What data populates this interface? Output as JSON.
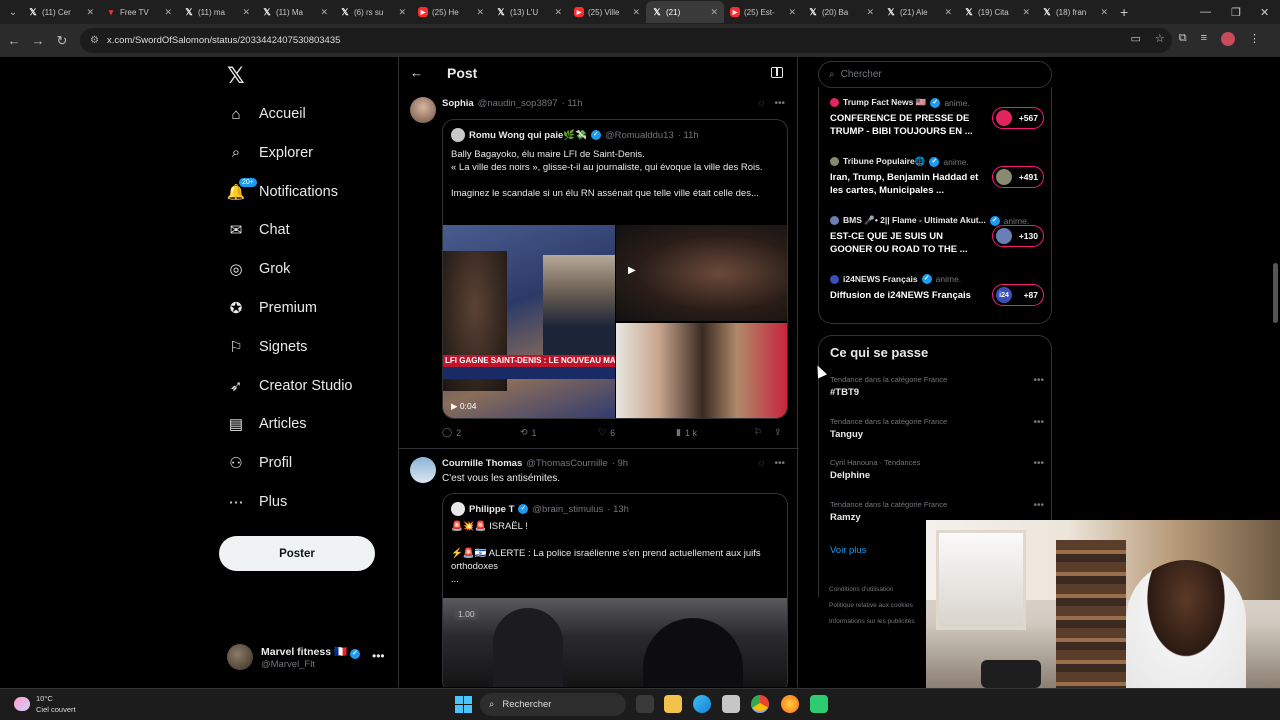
{
  "browser": {
    "tabs": [
      {
        "title": "(11) Cer",
        "icon": "x"
      },
      {
        "title": "Free TV",
        "icon": "freetv"
      },
      {
        "title": "(11) ma",
        "icon": "x"
      },
      {
        "title": "(11) Ma",
        "icon": "x"
      },
      {
        "title": "(6) rs su",
        "icon": "x"
      },
      {
        "title": "(25) He",
        "icon": "youtube"
      },
      {
        "title": "(13) L'U",
        "icon": "x"
      },
      {
        "title": "(25) Ville",
        "icon": "youtube"
      },
      {
        "title": "(21)",
        "icon": "x"
      },
      {
        "title": "(25) Est-",
        "icon": "youtube"
      },
      {
        "title": "(20) Ba",
        "icon": "x"
      },
      {
        "title": "(21) Ale",
        "icon": "x"
      },
      {
        "title": "(19) Cita",
        "icon": "x"
      },
      {
        "title": "(18) fran",
        "icon": "x"
      }
    ],
    "active_tab_index": 8,
    "url": "x.com/SwordOfSalomon/status/2033442407530803435"
  },
  "nav": {
    "items": [
      {
        "label": "Accueil",
        "icon": "home-icon"
      },
      {
        "label": "Explorer",
        "icon": "search-icon"
      },
      {
        "label": "Notifications",
        "icon": "bell-icon",
        "badge": "20+"
      },
      {
        "label": "Chat",
        "icon": "mail-icon"
      },
      {
        "label": "Grok",
        "icon": "grok-icon"
      },
      {
        "label": "Premium",
        "icon": "premium-icon"
      },
      {
        "label": "Signets",
        "icon": "bookmark-icon"
      },
      {
        "label": "Creator Studio",
        "icon": "rocket-icon"
      },
      {
        "label": "Articles",
        "icon": "article-icon"
      },
      {
        "label": "Profil",
        "icon": "person-icon"
      },
      {
        "label": "Plus",
        "icon": "more-circle-icon"
      }
    ],
    "post_button": "Poster",
    "profile": {
      "name": "Marvel fitness 🇫🇷",
      "handle": "@Marvel_Flt"
    }
  },
  "header": {
    "title": "Post"
  },
  "tweets": [
    {
      "name": "Sophia",
      "handle": "@naudin_sop3897",
      "time": "· 11h",
      "quote": {
        "name": "Romu Wong qui paie🌿💸",
        "handle": "@Romualddu13",
        "time": "· 11h",
        "lines": [
          "Bally Bagayoko, élu maire LFI de Saint-Denis.",
          "« La ville des noirs », glisse-t-il au journaliste, qui évoque la ville des Rois.",
          "",
          "Imaginez le scandale si un élu RN assénait que telle ville était celle des..."
        ],
        "video_banner": "LFI GAGNE SAINT-DENIS : LE NOUVEAU MA",
        "video_time": "0:04"
      },
      "stats": {
        "replies": "2",
        "reposts": "1",
        "likes": "6",
        "views": "1 k"
      }
    },
    {
      "name": "Cournille Thomas",
      "handle": "@ThomasCournille",
      "time": "· 9h",
      "text": "C'est vous les antisémites.",
      "quote": {
        "name": "Philippe T",
        "handle": "@brain_stimulus",
        "time": "· 13h",
        "line1": "🚨💥🚨 ISRAËL !",
        "line2": "⚡️🚨🇮🇱 ALERTE : La police israélienne s'en prend actuellement aux juifs orthodoxes",
        "line3": "...",
        "video_speed": "1.00"
      }
    }
  ],
  "search": {
    "placeholder": "Chercher"
  },
  "live": [
    {
      "source": "Trump Fact News 🇺🇸",
      "status": "anime.",
      "title": "CONFERENCE DE PRESSE DE TRUMP - BIBI TOUJOURS EN ...",
      "count": "+567",
      "color": "#e0245e"
    },
    {
      "source": "Tribune Populaire🌐",
      "status": "anime.",
      "title": "Iran, Trump, Benjamin Haddad et les cartes,  Municipales ...",
      "count": "+491",
      "color": "#8a8a70"
    },
    {
      "source": "BMS 🎤• 2|| Flame - Ultimate Akut...",
      "status": "anime.",
      "title": "EST-CE QUE JE SUIS UN GOONER OU ROAD TO THE ...",
      "count": "+130",
      "color": "#6a7fb8"
    },
    {
      "source": "i24NEWS Français",
      "status": "anime.",
      "title": "Diffusion de i24NEWS Français",
      "count": "+87",
      "color": "#3b4fb8",
      "pill_label": "i24"
    }
  ],
  "trends": {
    "title": "Ce qui se passe",
    "items": [
      {
        "category": "Tendance dans la catégorie France",
        "name": "#TBT9"
      },
      {
        "category": "Tendance dans la catégorie France",
        "name": "Tanguy"
      },
      {
        "category": "Cyril Hanouna · Tendances",
        "name": "Delphine"
      },
      {
        "category": "Tendance dans la catégorie France",
        "name": "Ramzy"
      }
    ],
    "see_more": "Voir plus"
  },
  "footer": [
    "Conditions d'utilisation",
    "Politique relative aux cookies",
    "Informations sur les publicités"
  ],
  "taskbar": {
    "weather_temp": "10°C",
    "weather_desc": "Ciel couvert",
    "search": "Rechercher"
  }
}
